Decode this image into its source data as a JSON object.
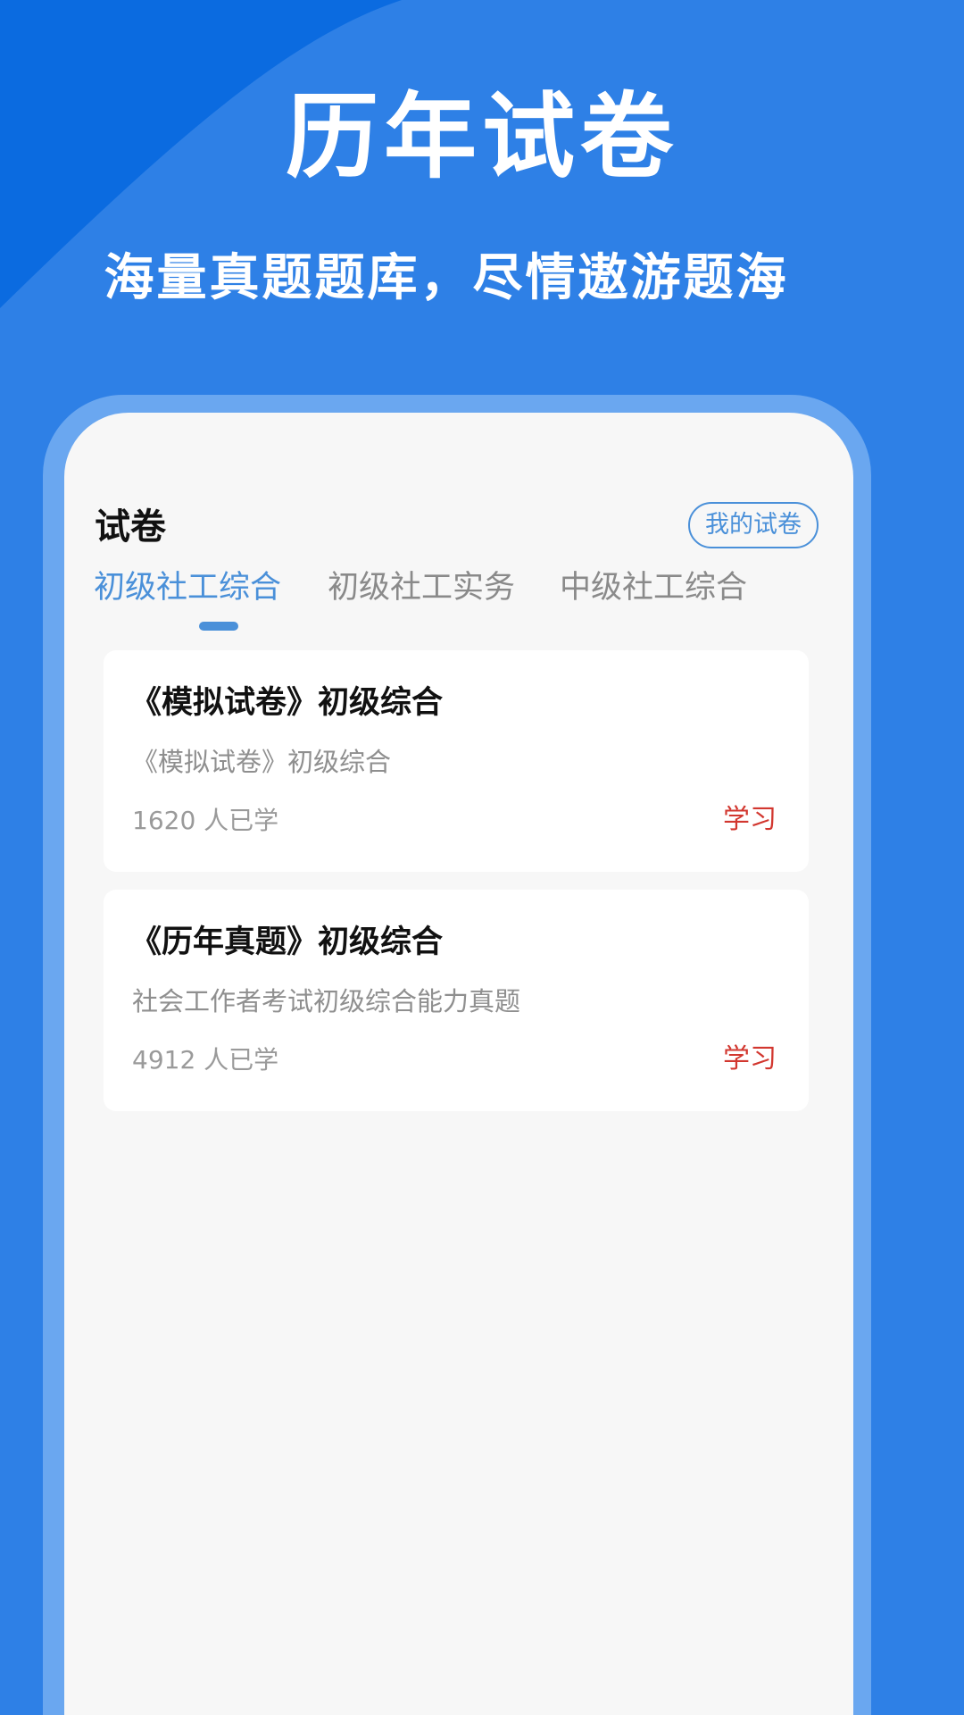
{
  "promo": {
    "title": "历年试卷",
    "subtitle": "海量真题题库，尽情遨游题海"
  },
  "screen": {
    "section_title": "试卷",
    "my_papers_label": "我的试卷",
    "tabs": [
      {
        "label": "初级社工综合",
        "active": true
      },
      {
        "label": "初级社工实务",
        "active": false
      },
      {
        "label": "中级社工综合",
        "active": false
      }
    ],
    "papers": [
      {
        "title": "《模拟试卷》初级综合",
        "description": "《模拟试卷》初级综合",
        "learners": "1620 人已学",
        "action_label": "学习"
      },
      {
        "title": "《历年真题》初级综合",
        "description": "社会工作者考试初级综合能力真题",
        "learners": "4912 人已学",
        "action_label": "学习"
      }
    ]
  },
  "colors": {
    "background": "#2e80e6",
    "accent": "#4a90d9",
    "action": "#d2372f"
  }
}
